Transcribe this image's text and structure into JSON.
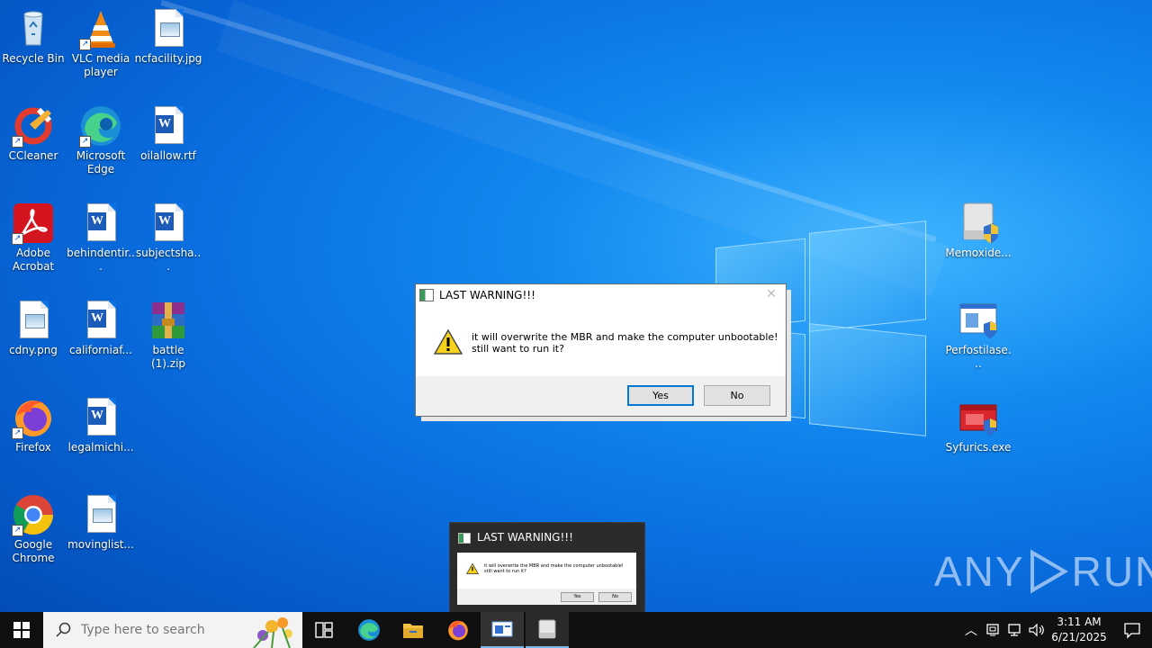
{
  "desktop": {
    "icons": [
      {
        "label": "Recycle Bin",
        "icon": "recycle-bin-icon"
      },
      {
        "label": "VLC media player",
        "icon": "vlc-icon"
      },
      {
        "label": "ncfacility.jpg",
        "icon": "image-file-icon"
      },
      {
        "label": "CCleaner",
        "icon": "ccleaner-icon"
      },
      {
        "label": "Microsoft Edge",
        "icon": "edge-icon"
      },
      {
        "label": "oilallow.rtf",
        "icon": "word-doc-icon"
      },
      {
        "label": "Adobe Acrobat",
        "icon": "acrobat-icon"
      },
      {
        "label": "behindentir...",
        "icon": "word-doc-icon"
      },
      {
        "label": "subjectsha...",
        "icon": "word-doc-icon"
      },
      {
        "label": "cdny.png",
        "icon": "image-file-icon"
      },
      {
        "label": "californiaf...",
        "icon": "word-doc-icon"
      },
      {
        "label": "battle (1).zip",
        "icon": "winrar-archive-icon"
      },
      {
        "label": "Firefox",
        "icon": "firefox-icon"
      },
      {
        "label": "legalmichi...",
        "icon": "word-doc-icon"
      },
      {
        "label": "Google Chrome",
        "icon": "chrome-icon"
      },
      {
        "label": "movinglist...",
        "icon": "image-file-icon"
      },
      {
        "label": "Memoxide...",
        "icon": "drive-shield-icon"
      },
      {
        "label": "Perfostilase...",
        "icon": "app-shield-icon"
      },
      {
        "label": "Syfurics.exe",
        "icon": "red-app-shield-icon"
      }
    ]
  },
  "dialog": {
    "title": "LAST WARNING!!!",
    "message_line1": "it will overwrite the MBR and make the computer unbootable!",
    "message_line2": "still want to run it?",
    "yes_label": "Yes",
    "no_label": "No"
  },
  "thumbnail": {
    "title": "LAST WARNING!!!",
    "message_line1": "it will overwrite the MBR and make the computer unbootable!",
    "message_line2": "still want to run it?",
    "yes_label": "Yes",
    "no_label": "No"
  },
  "watermark": {
    "left": "ANY",
    "right": "RUN"
  },
  "taskbar": {
    "search_placeholder": "Type here to search",
    "apps": [
      "task-view-icon",
      "edge-icon",
      "file-explorer-icon",
      "firefox-icon",
      "dialog-app-icon",
      "drive-app-icon"
    ],
    "clock_time": "3:11 AM",
    "clock_date": "6/21/2025"
  }
}
